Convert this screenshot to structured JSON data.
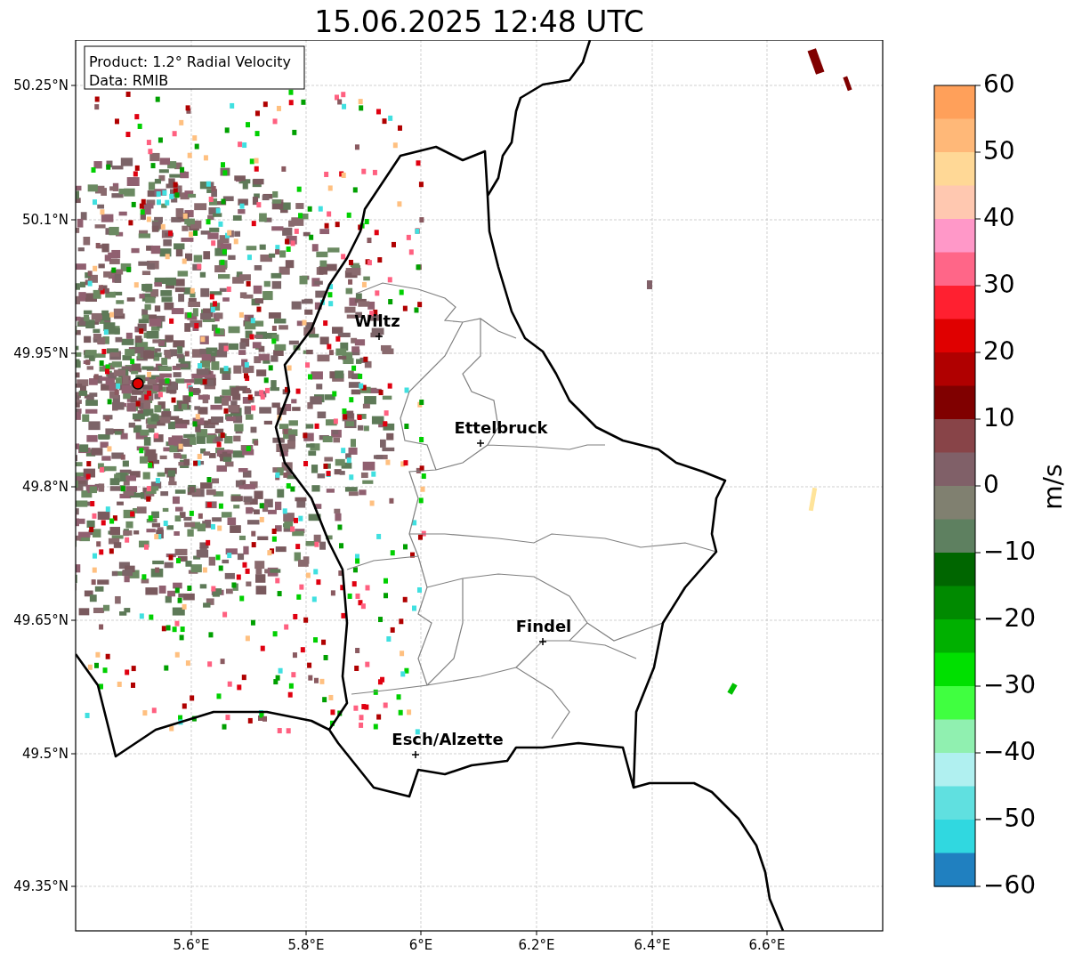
{
  "title": "15.06.2025 12:48 UTC",
  "map": {
    "info_box": [
      "Product: 1.2° Radial Velocity",
      "Data: RMIB"
    ],
    "y_ticks": [
      "50.25°N",
      "50.1°N",
      "49.95°N",
      "49.8°N",
      "49.65°N",
      "49.5°N",
      "49.35°N"
    ],
    "x_ticks": [
      "5.6°E",
      "5.8°E",
      "6°E",
      "6.2°E",
      "6.4°E",
      "6.6°E"
    ],
    "places": [
      {
        "name": "Wiltz"
      },
      {
        "name": "Ettelbruck"
      },
      {
        "name": "Findel"
      },
      {
        "name": "Esch/Alzette"
      }
    ]
  },
  "colorbar": {
    "label": "m/s",
    "ticks": [
      "60",
      "50",
      "40",
      "30",
      "20",
      "10",
      "0",
      "−10",
      "−20",
      "−30",
      "−40",
      "−50",
      "−60"
    ]
  }
}
